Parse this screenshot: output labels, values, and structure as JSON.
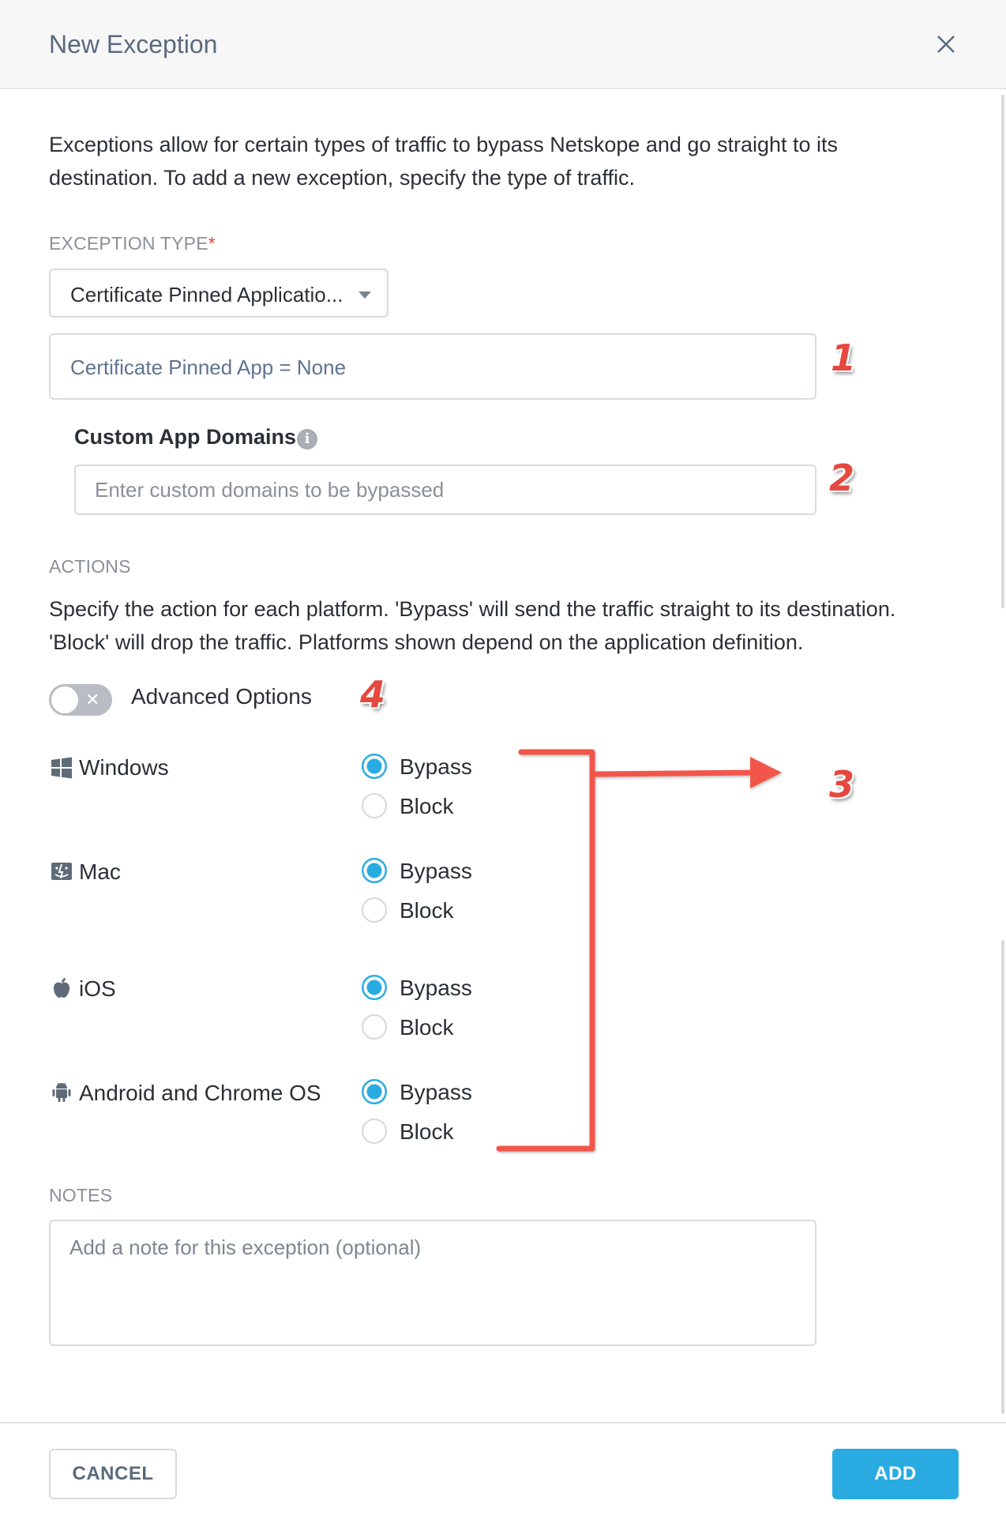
{
  "dialog": {
    "title": "New Exception"
  },
  "intro": "Exceptions allow for certain types of traffic to bypass Netskope and go straight to its destination. To add a new exception, specify the type of traffic.",
  "exception_type": {
    "label": "EXCEPTION TYPE",
    "required_mark": "*",
    "selected": "Certificate Pinned Applicatio...",
    "app_field_value": "Certificate Pinned App = None"
  },
  "custom_domains": {
    "label": "Custom App Domains",
    "info_icon": "i",
    "placeholder": "Enter custom domains to be bypassed"
  },
  "actions": {
    "label": "ACTIONS",
    "description": "Specify the action for each platform. 'Bypass' will send the traffic straight to its destination. 'Block' will drop the traffic. Platforms shown depend on the application definition.",
    "advanced_options_label": "Advanced Options",
    "advanced_options_enabled": false,
    "bypass_label": "Bypass",
    "block_label": "Block",
    "platforms": [
      {
        "name": "Windows",
        "icon": "windows-icon",
        "selected": "Bypass"
      },
      {
        "name": "Mac",
        "icon": "mac-finder-icon",
        "selected": "Bypass"
      },
      {
        "name": "iOS",
        "icon": "apple-icon",
        "selected": "Bypass"
      },
      {
        "name": "Android and Chrome OS",
        "icon": "android-icon",
        "selected": "Bypass"
      }
    ]
  },
  "notes": {
    "label": "NOTES",
    "placeholder": "Add a note for this exception (optional)"
  },
  "footer": {
    "cancel_label": "CANCEL",
    "add_label": "ADD"
  },
  "annotations": [
    "1",
    "2",
    "3",
    "4"
  ],
  "colors": {
    "accent": "#29abe2",
    "annotation": "#e5483f",
    "required": "#e0443e"
  }
}
